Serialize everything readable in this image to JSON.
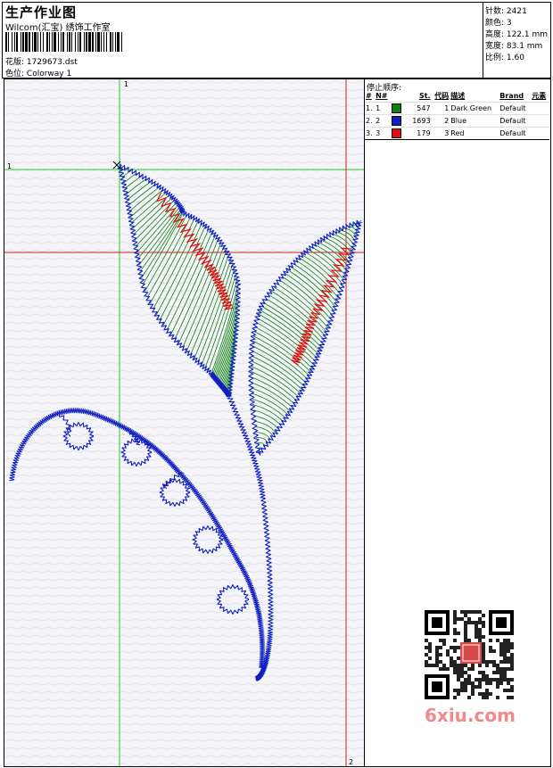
{
  "header": {
    "title": "生产作业图",
    "company": "Wilcom(汇宝) 绣饰工作室",
    "design_label": "花版:",
    "design_value": "1729673.dst",
    "colorway_label": "色位:",
    "colorway_value": "Colorway 1"
  },
  "stats": {
    "stitches": "针数: 2421",
    "colors": "颜色: 3",
    "height": "高度: 122.1 mm",
    "width": "宽度: 83.1 mm",
    "scale": "比例: 1.60"
  },
  "guides": {
    "v1_label": "1",
    "h1_label": "1",
    "v2_label": "2"
  },
  "stop_sequence": {
    "title": "停止顺序:",
    "columns": [
      "#",
      "N#",
      "St.",
      "代码",
      "描述",
      "Brand",
      "元素"
    ],
    "rows": [
      {
        "idx": "1.",
        "n": "1",
        "st": "547",
        "code": "1",
        "desc": "Dark Green",
        "brand": "Default",
        "color": "#108010"
      },
      {
        "idx": "2.",
        "n": "2",
        "st": "1693",
        "code": "2",
        "desc": "Blue",
        "brand": "Default",
        "color": "#1020c0"
      },
      {
        "idx": "3.",
        "n": "3",
        "st": "179",
        "code": "3",
        "desc": "Red",
        "brand": "Default",
        "color": "#e01010"
      }
    ]
  },
  "watermark": {
    "site": "6xiu.com",
    "seal": "纹绣图库"
  },
  "colors": {
    "green": "#108010",
    "blue": "#1020c0",
    "red": "#e01010",
    "guide_green": "#22cc22",
    "guide_red": "#cc2020"
  }
}
